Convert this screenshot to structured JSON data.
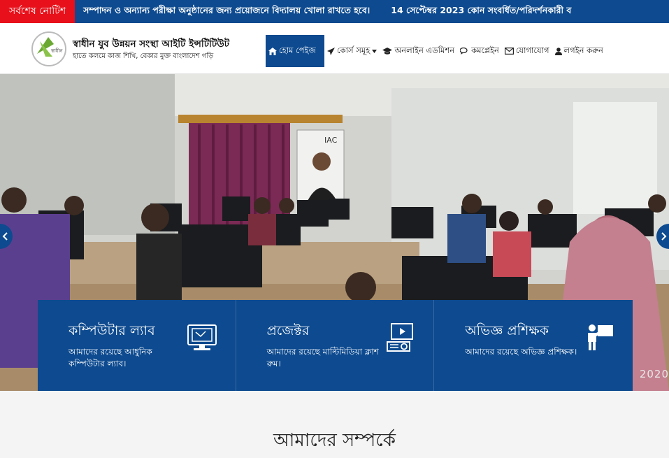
{
  "notice": {
    "label": "সর্বশেষ নোটিশ",
    "items": [
      "সম্পাদন ও অন্যান্য পরীক্ষা অনুষ্ঠানের জন্য প্রয়োজনে বিদ্যালয় খোলা রাখতে হবে।",
      "14 সেপ্টেম্বর 2023 কোন সংবর্ধিত/পরিদর্শনকারী ব"
    ]
  },
  "brand": {
    "title": "স্বাধীন যুব উন্নয়ন সংস্থা আইটি ইন্সটিটিউট",
    "tagline": "হাতে কলমে কাজ শিখি, বেকার মুক্ত বাংলাদেশ গড়ি",
    "logo_text": "স্বাধীন"
  },
  "nav": [
    {
      "label": "হোম পেইজ",
      "icon": "home-icon"
    },
    {
      "label": "কোর্স সমূহ",
      "icon": "paper-plane-icon"
    },
    {
      "label": "অনলাইন এডমিশন",
      "icon": "graduation-cap-icon"
    },
    {
      "label": "কমপ্লেইন",
      "icon": "comments-icon"
    },
    {
      "label": "যোগাযোগ",
      "icon": "envelope-icon"
    },
    {
      "label": "লগইন করুন",
      "icon": "user-icon"
    }
  ],
  "hero": {
    "wall_poster_text": "IAC",
    "year_stamp": "2020"
  },
  "features": [
    {
      "title": "কম্পিউটার ল্যাব",
      "desc": "আমাদের রয়েছে আধুনিক কম্পিউটার ল্যাব।",
      "icon": "computer-lab-icon"
    },
    {
      "title": "প্রজেক্টর",
      "desc": "আমাদের রয়েছে মাল্টিমিডিয়া ক্লাশ রুম।",
      "icon": "projector-icon"
    },
    {
      "title": "অভিজ্ঞ প্রশিক্ষক",
      "desc": "আমাদের রয়েছে অভিজ্ঞ প্রশিক্ষক।",
      "icon": "trainer-icon"
    }
  ],
  "about": {
    "title": "আমাদের সম্পর্কে"
  },
  "colors": {
    "primary": "#0d4a8f",
    "notice_red": "#e8101a"
  }
}
